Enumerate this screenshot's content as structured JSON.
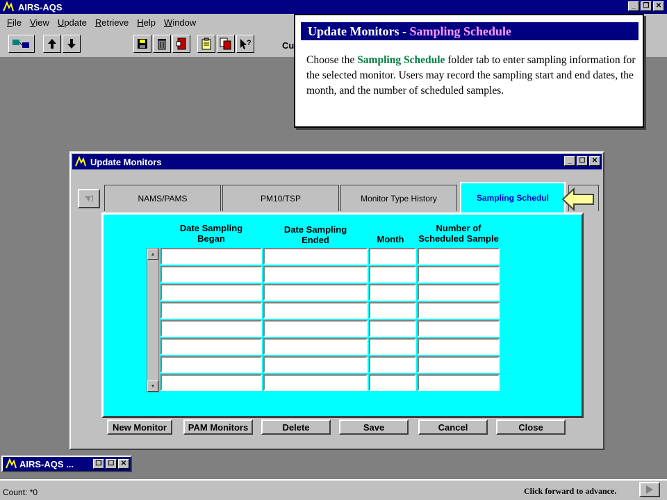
{
  "app": {
    "title": "AIRS-AQS"
  },
  "menu": {
    "items": [
      {
        "first": "F",
        "rest": "ile"
      },
      {
        "first": "V",
        "rest": "iew"
      },
      {
        "first": "U",
        "rest": "pdate"
      },
      {
        "first": "R",
        "rest": "etrieve"
      },
      {
        "first": "H",
        "rest": "elp"
      },
      {
        "first": "W",
        "rest": "indow"
      }
    ]
  },
  "toolbar": {
    "partial_text": "Cu"
  },
  "tooltip": {
    "title_main": "Update Monitors - ",
    "title_accent": "Sampling Schedule",
    "body_pre": "Choose the ",
    "body_highlight": "Sampling Schedule",
    "body_post": " folder tab to enter sampling information for the selected monitor.  Users may record the sampling start and end dates, the month, and the number of scheduled samples."
  },
  "window": {
    "title": "Update Monitors",
    "tabs": [
      "NAMS/PAMS",
      "PM10/TSP",
      "Monitor Type History",
      "Sampling Schedul"
    ],
    "columns": [
      {
        "line1": "Date Sampling",
        "line2": "Began"
      },
      {
        "line1": "Date Sampling",
        "line2": "Ended"
      },
      {
        "line1": "Month",
        "line2": ""
      },
      {
        "line1": "Number of",
        "line2": "Scheduled Sample"
      }
    ],
    "buttons": [
      "New Monitor",
      "PAM Monitors",
      "Delete",
      "Save",
      "Cancel",
      "Close"
    ]
  },
  "minimized": {
    "title": "AIRS-AQS ..."
  },
  "status": {
    "count": "Count: *0",
    "advance": "Click forward to advance."
  },
  "colors": {
    "titlebar": "#000080",
    "panel": "#00ffff",
    "highlight": "#008040",
    "accent": "#ff99ff"
  },
  "icons": [
    "app-icon",
    "connect-icon",
    "up-arrow-icon",
    "down-arrow-icon",
    "save-icon",
    "trash-icon",
    "exit-icon",
    "clipboard-icon",
    "copy-icon",
    "help-icon",
    "hand-pointer-icon",
    "forward-icon"
  ]
}
